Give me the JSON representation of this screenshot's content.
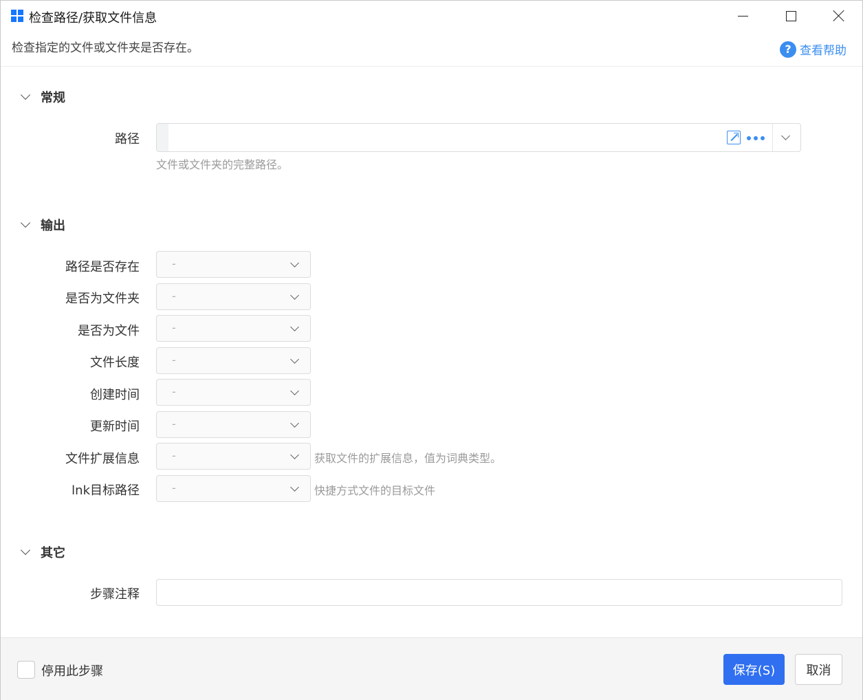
{
  "window": {
    "title": "检查路径/获取文件信息",
    "description": "检查指定的文件或文件夹是否存在。",
    "help_label": "查看帮助"
  },
  "colors": {
    "accent": "#2f6ff0",
    "link": "#3b8ef0"
  },
  "sections": {
    "general": {
      "title": "常规",
      "path_label": "路径",
      "path_value": "",
      "path_hint": "文件或文件夹的完整路径。"
    },
    "output": {
      "title": "输出",
      "fields": [
        {
          "label": "路径是否存在",
          "value": "-",
          "hint": ""
        },
        {
          "label": "是否为文件夹",
          "value": "-",
          "hint": ""
        },
        {
          "label": "是否为文件",
          "value": "-",
          "hint": ""
        },
        {
          "label": "文件长度",
          "value": "-",
          "hint": ""
        },
        {
          "label": "创建时间",
          "value": "-",
          "hint": ""
        },
        {
          "label": "更新时间",
          "value": "-",
          "hint": ""
        },
        {
          "label": "文件扩展信息",
          "value": "-",
          "hint": "获取文件的扩展信息，值为词典类型。"
        },
        {
          "label": "lnk目标路径",
          "value": "-",
          "hint": "快捷方式文件的目标文件"
        }
      ]
    },
    "other": {
      "title": "其它",
      "note_label": "步骤注释",
      "note_value": ""
    }
  },
  "footer": {
    "disable_label": "停用此步骤",
    "save_label": "保存(S)",
    "cancel_label": "取消"
  }
}
